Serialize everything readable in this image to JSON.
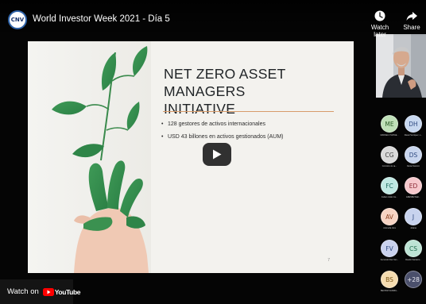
{
  "video": {
    "title": "World Investor Week 2021 - Día 5",
    "channel_logo_text": "CNV",
    "watch_later_label": "Watch later",
    "share_label": "Share",
    "watch_on_label": "Watch on",
    "youtube_label": "YouTube",
    "icons": {
      "watch_later": "clock-icon",
      "share": "share-arrow-icon",
      "play": "play-icon",
      "youtube": "youtube-logo-icon"
    },
    "colors": {
      "youtube_red": "#ff0000"
    }
  },
  "slide": {
    "heading_line1": "NET ZERO ASSET MANAGERS",
    "heading_line2": "INITIATIVE",
    "bullets": [
      "128 gestores de activos internacionales",
      "USD 43 billones en activos gestionados (AUM)"
    ],
    "page_number": "7",
    "accent_color": "#d89c6a"
  },
  "participants": [
    {
      "initials": "ME",
      "name": "MARCELO SCHAE...",
      "color": "#bfe0b8"
    },
    {
      "initials": "DH",
      "name": "Diana Henriquez, L...",
      "color": "#c8d8f0"
    },
    {
      "initials": "CG",
      "name": "Comisión de va...",
      "color": "#d9d9d9"
    },
    {
      "initials": "DS",
      "name": "Daniel Santoro",
      "color": "#c9d6ee"
    },
    {
      "initials": "FC",
      "name": "Fabian Julián Ca...",
      "color": "#bfe8e2"
    },
    {
      "initials": "ED",
      "name": "ERENBIZ Malt...",
      "color": "#f6c8cc"
    },
    {
      "initials": "AV",
      "name": "Antonella Vera",
      "color": "#f6d3c3"
    },
    {
      "initials": "J",
      "name": "Juliana",
      "color": "#c8d3ee"
    },
    {
      "initials": "FV",
      "name": "Fernando Díaz Van...",
      "color": "#cad2ee"
    },
    {
      "initials": "CS",
      "name": "Claudio Santacru...",
      "color": "#bde3d4"
    },
    {
      "initials": "BS",
      "name": "BEATRIZ SANMIG...",
      "color": "#f5dcb0"
    },
    {
      "initials": "+28",
      "name": "",
      "color": "#4a4f6b"
    }
  ]
}
